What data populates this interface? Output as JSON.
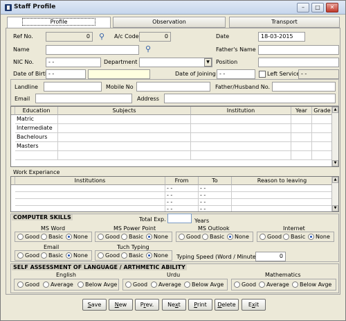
{
  "window": {
    "title": "Staff Profile",
    "minimize": "–",
    "maximize": "□",
    "close": "✕"
  },
  "tabs": [
    {
      "label": "Profile"
    },
    {
      "label": "Observation"
    },
    {
      "label": "Transport"
    }
  ],
  "profile": {
    "ref_no_label": "Ref No.",
    "ref_no": "0",
    "ac_code_label": "A/c Code",
    "ac_code": "0",
    "date_label": "Date",
    "date": "18-03-2015",
    "name_label": "Name",
    "name": "",
    "fathers_name_label": "Father's Name",
    "fathers_name": "",
    "nic_label": "NIC No.",
    "nic": "   -       -",
    "department_label": "Department",
    "department": "",
    "position_label": "Position",
    "position": "",
    "dob_label": "Date of Birth",
    "dob": " -  -",
    "age": "",
    "doj_label": "Date of Joining",
    "doj": " -  -",
    "left_service_label": "Left Service",
    "left_service": " -  -"
  },
  "contact": {
    "landline_label": "Landline",
    "landline": "",
    "mobile_label": "Mobile No",
    "mobile": "",
    "father_husband_label": "Father/Husband No.",
    "father_husband": "",
    "email_label": "Email",
    "email": "",
    "address_label": "Address",
    "address": ""
  },
  "education": {
    "headers": [
      "Education",
      "Subjects",
      "Institution",
      "Year",
      "Grade"
    ],
    "rows": [
      "Matric",
      "Intermediate",
      "Bachelours",
      "Masters",
      "",
      ""
    ]
  },
  "work": {
    "title": "Work Experiance",
    "headers": [
      "Institutions",
      "From",
      "To",
      "Reason to leaving"
    ],
    "rows": [
      {
        "from": " -  -",
        "to": " -  -"
      },
      {
        "from": " -  -",
        "to": " -  -"
      },
      {
        "from": " -  -",
        "to": " -  -"
      },
      {
        "from": " -  -",
        "to": " -  -"
      }
    ]
  },
  "computer": {
    "title": "COMPUTER SKILLS",
    "total_exp_label": "Total Exp.",
    "total_exp": "",
    "years_label": "Years",
    "skills": [
      {
        "name": "MS Word",
        "selected": "None"
      },
      {
        "name": "MS Power Point",
        "selected": "None"
      },
      {
        "name": "MS Outlook",
        "selected": "None"
      },
      {
        "name": "Internet",
        "selected": "None"
      },
      {
        "name": "Email",
        "selected": "None"
      },
      {
        "name": "Tuch Typing",
        "selected": "None"
      }
    ],
    "opt_good": "Good",
    "opt_basic": "Basic",
    "opt_none": "None",
    "typing_speed_label": "Typing Speed (Word / Minute)",
    "typing_speed": "0"
  },
  "language": {
    "title": "SELF ASSESSMENT OF LANGUAGE / ARTHMETIC ABILITY",
    "items": [
      {
        "name": "English"
      },
      {
        "name": "Urdu"
      },
      {
        "name": "Mathematics"
      }
    ],
    "opt_good": "Good",
    "opt_average": "Average",
    "opt_below": "Below Avge"
  },
  "buttons": {
    "save_pre": "",
    "save_key": "S",
    "save_post": "ave",
    "new_pre": "",
    "new_key": "N",
    "new_post": "ew",
    "prev_pre": "P",
    "prev_key": "r",
    "prev_post": "ev.",
    "next_pre": "Ne",
    "next_key": "x",
    "next_post": "t",
    "print_pre": "",
    "print_key": "P",
    "print_post": "rint",
    "delete_pre": "",
    "delete_key": "D",
    "delete_post": "elete",
    "exit_pre": "E",
    "exit_key": "x",
    "exit_post": "it"
  }
}
